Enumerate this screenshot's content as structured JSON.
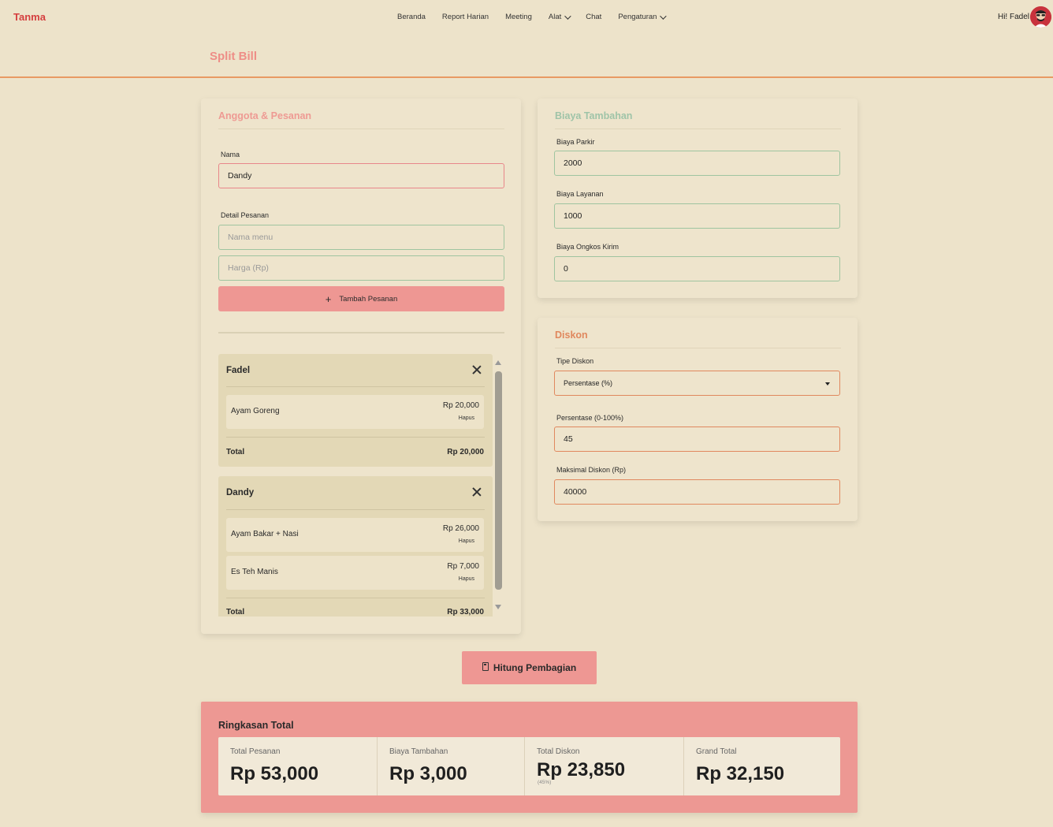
{
  "colors": {
    "background": "#EDE3CA",
    "brand": "#D53F3F",
    "accent_pink": "#EE9793",
    "title_pink": "#EE8E87",
    "accent_green": "#9FC4A0",
    "accent_orange": "#E0885E"
  },
  "navbar": {
    "brand": "Tanma",
    "items": [
      {
        "label": "Beranda"
      },
      {
        "label": "Report Harian"
      },
      {
        "label": "Meeting"
      },
      {
        "label": "Alat",
        "dropdown": true
      },
      {
        "label": "Chat"
      },
      {
        "label": "Pengaturan",
        "dropdown": true
      }
    ],
    "greeting": "Hi! Fadel",
    "avatar_icon": "user-avatar-icon"
  },
  "page": {
    "title": "Split Bill"
  },
  "members_card": {
    "title": "Anggota & Pesanan",
    "name_label": "Nama",
    "name_value": "Dandy",
    "detail_label": "Detail Pesanan",
    "menu_placeholder": "Nama menu",
    "price_placeholder": "Harga (Rp)",
    "add_button": "Tambah Pesanan",
    "members": [
      {
        "name": "Fadel",
        "orders": [
          {
            "name": "Ayam Goreng",
            "price": "Rp 20,000",
            "delete": "Hapus"
          }
        ],
        "total_label": "Total",
        "total": "Rp 20,000"
      },
      {
        "name": "Dandy",
        "orders": [
          {
            "name": "Ayam Bakar + Nasi",
            "price": "Rp 26,000",
            "delete": "Hapus"
          },
          {
            "name": "Es Teh Manis",
            "price": "Rp 7,000",
            "delete": "Hapus"
          }
        ],
        "total_label": "Total",
        "total": "Rp 33,000"
      }
    ]
  },
  "fees_card": {
    "title": "Biaya Tambahan",
    "parking_label": "Biaya Parkir",
    "parking_value": "2000",
    "service_label": "Biaya Layanan",
    "service_value": "1000",
    "shipping_label": "Biaya Ongkos Kirim",
    "shipping_value": "0"
  },
  "discount_card": {
    "title": "Diskon",
    "type_label": "Tipe Diskon",
    "type_value": "Persentase (%)",
    "percent_label": "Persentase (0-100%)",
    "percent_value": "45",
    "max_label": "Maksimal Diskon (Rp)",
    "max_value": "40000"
  },
  "calculate_button": "Hitung Pembagian",
  "summary": {
    "title": "Ringkasan Total",
    "stats": [
      {
        "label": "Total Pesanan",
        "value": "Rp 53,000"
      },
      {
        "label": "Biaya Tambahan",
        "value": "Rp 3,000"
      },
      {
        "label": "Total Diskon",
        "value": "Rp 23,850",
        "sub": "(45%)"
      },
      {
        "label": "Grand Total",
        "value": "Rp 32,150"
      }
    ]
  }
}
